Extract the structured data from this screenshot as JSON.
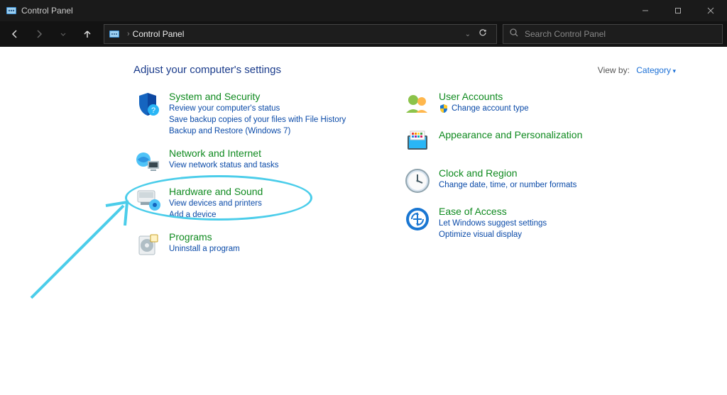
{
  "window": {
    "title": "Control Panel"
  },
  "addressbar": {
    "location": "Control Panel"
  },
  "search": {
    "placeholder": "Search Control Panel"
  },
  "heading": "Adjust your computer's settings",
  "viewby": {
    "label": "View by:",
    "value": "Category"
  },
  "left": [
    {
      "title": "System and Security",
      "links": [
        "Review your computer's status",
        "Save backup copies of your files with File History",
        "Backup and Restore (Windows 7)"
      ]
    },
    {
      "title": "Network and Internet",
      "links": [
        "View network status and tasks"
      ]
    },
    {
      "title": "Hardware and Sound",
      "links": [
        "View devices and printers",
        "Add a device"
      ]
    },
    {
      "title": "Programs",
      "links": [
        "Uninstall a program"
      ]
    }
  ],
  "right": [
    {
      "title": "User Accounts",
      "links": [
        "Change account type"
      ],
      "shield": true
    },
    {
      "title": "Appearance and Personalization",
      "links": []
    },
    {
      "title": "Clock and Region",
      "links": [
        "Change date, time, or number formats"
      ]
    },
    {
      "title": "Ease of Access",
      "links": [
        "Let Windows suggest settings",
        "Optimize visual display"
      ]
    }
  ],
  "colors": {
    "accent_green": "#0f8a1f",
    "link_blue": "#0a4aa8",
    "heading_blue": "#1a3b8b",
    "annotation": "#4bcdea"
  }
}
